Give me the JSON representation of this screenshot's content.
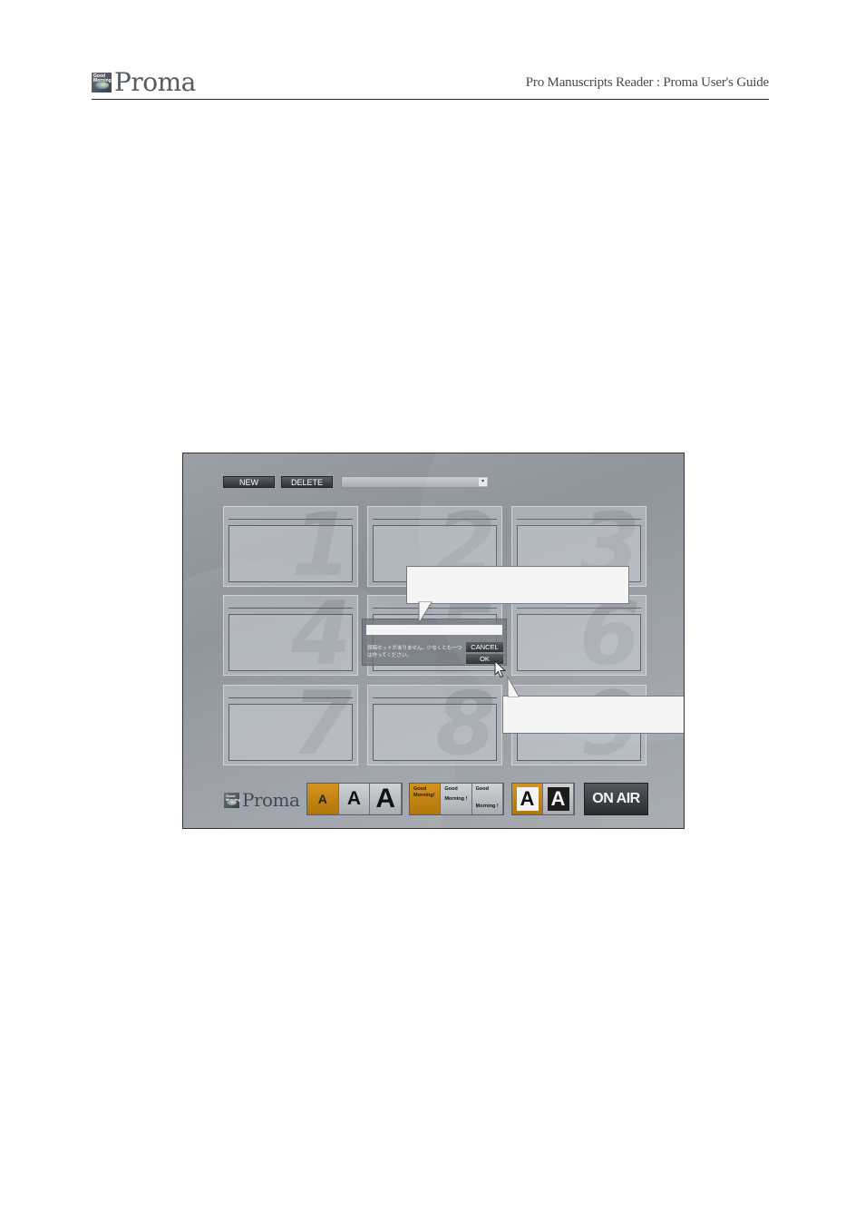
{
  "header": {
    "logo_text": "Proma",
    "logo_badge_text": "Good Morning",
    "doc_title": "Pro Manuscripts Reader : Proma User's Guide"
  },
  "app": {
    "toolbar": {
      "new_label": "NEW",
      "delete_label": "DELETE",
      "select_value": ""
    },
    "grid": [
      {
        "number": "1"
      },
      {
        "number": "2"
      },
      {
        "number": "3"
      },
      {
        "number": "4"
      },
      {
        "number": "5"
      },
      {
        "number": "6"
      },
      {
        "number": "7"
      },
      {
        "number": "8"
      },
      {
        "number": "9"
      }
    ],
    "dialog": {
      "message": "原稿セットがありません。少なくとも一つは作ってください。",
      "cancel_label": "CANCEL",
      "ok_label": "OK"
    },
    "bottom_bar": {
      "logo_text": "Proma",
      "size_buttons": [
        "A",
        "A",
        "A"
      ],
      "phrase_buttons": [
        {
          "line1": "Good",
          "line2": "Morning!"
        },
        {
          "line1": "Good",
          "line2": "Morning !"
        },
        {
          "line1": "Good",
          "line2": "Morning !"
        }
      ],
      "invert_buttons": [
        "A",
        "A"
      ],
      "onair_label": "ON AIR"
    },
    "colors": {
      "accent_orange": "#c4840f",
      "button_dark": "#2f3337"
    }
  }
}
